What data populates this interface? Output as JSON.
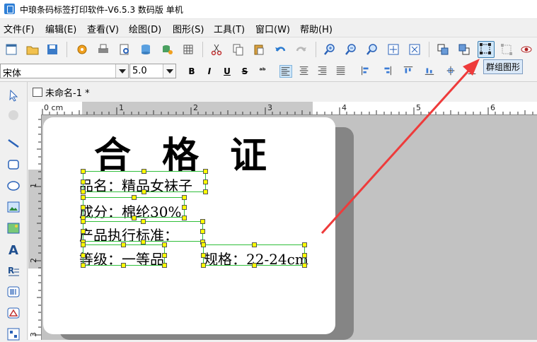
{
  "window": {
    "title": "中琅条码标签打印软件-V6.5.3 数码版 单机"
  },
  "menu": [
    "文件(F)",
    "编辑(E)",
    "查看(V)",
    "绘图(D)",
    "图形(S)",
    "工具(T)",
    "窗口(W)",
    "帮助(H)"
  ],
  "toolbar2": {
    "font_name": "宋体",
    "font_size": "5.0"
  },
  "tooltip": "群组图形",
  "document": {
    "tab_label": "未命名-1 *"
  },
  "ruler": {
    "unit_label": "0 cm",
    "h_marks": [
      "1",
      "2",
      "3",
      "4",
      "5",
      "6"
    ],
    "v_marks": [
      "1",
      "2",
      "3"
    ]
  },
  "label": {
    "heading": "合格证",
    "fields": {
      "product_name": "品名：精品女袜子",
      "composition": "成分：棉纶30%",
      "standard": "产品执行标准：",
      "grade": "等级：一等品",
      "spec": "规格：22-24cm"
    }
  },
  "colors": {
    "selection": "#2fbf3a",
    "handle": "#ffff00",
    "annotation_arrow": "#ee3b3b",
    "accent": "#3c7fb1"
  }
}
